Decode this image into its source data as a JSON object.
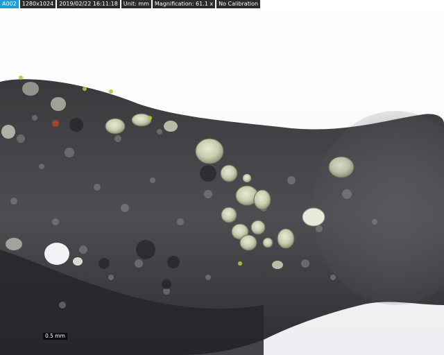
{
  "hud": {
    "id": "A002",
    "resolution": "1280x1024",
    "datetime": "2019/02/22 16:11:18",
    "unit": "Unit: mm",
    "magnification": "Magnification: 61.1 x",
    "calibration": "No Calibration"
  },
  "scale_bar": {
    "label": "0.5 mm"
  },
  "colors": {
    "bark_dark": "#2a2a2c",
    "bark_mid": "#4a4a4e",
    "lichen_green": "#c9cfb0",
    "hud_bg": "#2b2b2b",
    "hud_accent": "#1f9bd6"
  }
}
